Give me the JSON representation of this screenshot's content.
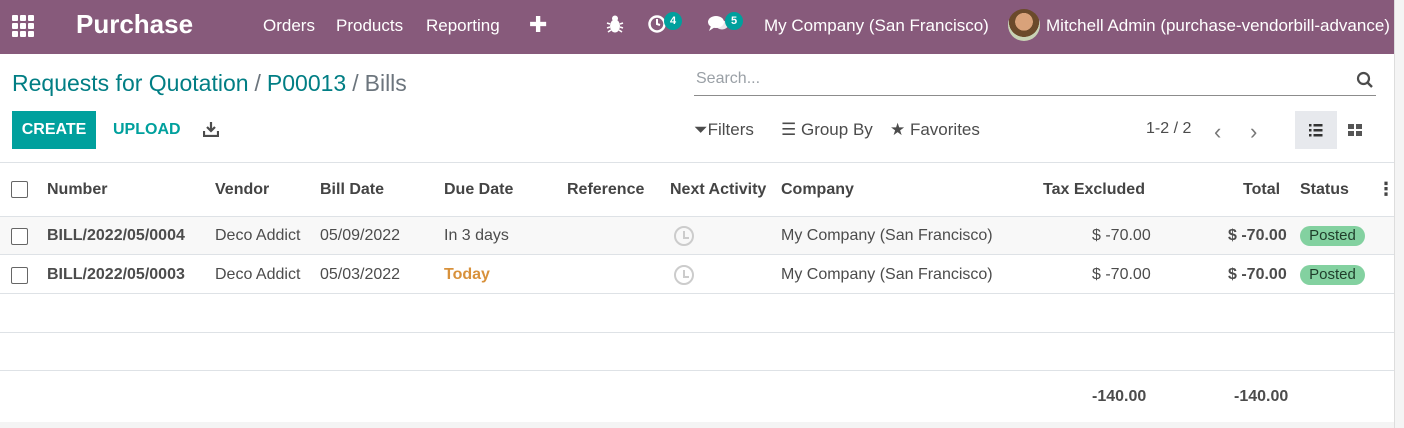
{
  "navbar": {
    "app_title": "Purchase",
    "menu": [
      "Orders",
      "Products",
      "Reporting"
    ],
    "activity_count": "4",
    "message_count": "5",
    "company": "My Company (San Francisco)",
    "user": "Mitchell Admin (purchase-vendorbill-advance)",
    "color": "#875a7b"
  },
  "breadcrumb": {
    "items": [
      "Requests for Quotation",
      "P00013"
    ],
    "current": "Bills",
    "separator": "/"
  },
  "search": {
    "placeholder": "Search..."
  },
  "actions": {
    "create": "CREATE",
    "upload": "UPLOAD"
  },
  "filters": {
    "filters": "Filters",
    "group_by": "Group By",
    "favorites": "Favorites"
  },
  "pager": {
    "value": "1-2 / 2"
  },
  "table": {
    "columns": [
      "Number",
      "Vendor",
      "Bill Date",
      "Due Date",
      "Reference",
      "Next Activity",
      "Company",
      "Tax Excluded",
      "Total",
      "Status"
    ],
    "rows": [
      {
        "number": "BILL/2022/05/0004",
        "vendor": "Deco Addict",
        "bill_date": "05/09/2022",
        "due_date": "In 3 days",
        "reference": "",
        "company": "My Company (San Francisco)",
        "tax_excluded": "$ -70.00",
        "total": "$ -70.00",
        "status": "Posted"
      },
      {
        "number": "BILL/2022/05/0003",
        "vendor": "Deco Addict",
        "bill_date": "05/03/2022",
        "due_date": "Today",
        "reference": "",
        "company": "My Company (San Francisco)",
        "tax_excluded": "$ -70.00",
        "total": "$ -70.00",
        "status": "Posted"
      }
    ],
    "totals": {
      "tax_excluded": "-140.00",
      "total": "-140.00"
    }
  },
  "colors": {
    "accent": "#00a09d",
    "posted_badge": "#83d1a0",
    "today": "#d8913b"
  }
}
